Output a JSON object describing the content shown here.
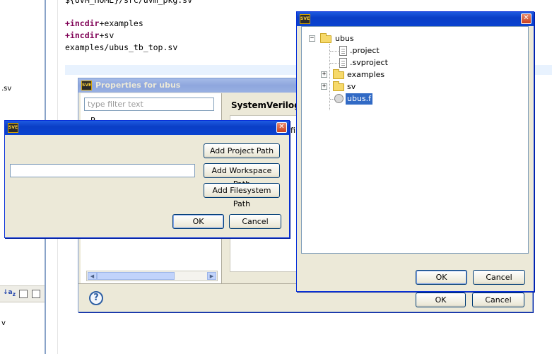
{
  "editor": {
    "top_line": "${UVM_HOME}/src/uvm_pkg.sv",
    "lines": [
      {
        "kw": "+incdir",
        "rest": "+examples"
      },
      {
        "kw": "+incdir",
        "rest": "+sv"
      },
      {
        "kw": "",
        "rest": "examples/ubus_tb_top.sv"
      }
    ],
    "left_fragment_1": ".sv",
    "left_fragment_2": "v"
  },
  "properties_dialog": {
    "title": "Properties for ubus",
    "filter_placeholder": "type filter text",
    "heading": "SystemVerilog",
    "tree_fragment": "P",
    "file_fragment": "file",
    "ok_label": "OK",
    "cancel_label": "Cancel",
    "help_icon": "help-icon"
  },
  "path_dialog": {
    "title": "",
    "path_value": "",
    "add_project_path": "Add Project Path",
    "add_workspace_path": "Add Workspace Path",
    "add_filesystem_path": "Add Filesystem Path",
    "ok_label": "OK",
    "cancel_label": "Cancel"
  },
  "file_dialog": {
    "title": "",
    "tree": [
      {
        "label": "ubus",
        "type": "folder-open",
        "expander": "−"
      },
      {
        "label": ".project",
        "type": "file"
      },
      {
        "label": ".svproject",
        "type": "file"
      },
      {
        "label": "examples",
        "type": "folder",
        "expander": "+"
      },
      {
        "label": "sv",
        "type": "folder",
        "expander": "+"
      },
      {
        "label": "ubus.f",
        "type": "gear-file",
        "selected": true
      }
    ],
    "ok_label": "OK",
    "cancel_label": "Cancel"
  },
  "colors": {
    "title_active": "#0a3ec6",
    "title_inactive": "#8ea6de",
    "dialog_bg": "#ece9d8",
    "selection": "#316ac5",
    "keyword": "#7f0055"
  }
}
